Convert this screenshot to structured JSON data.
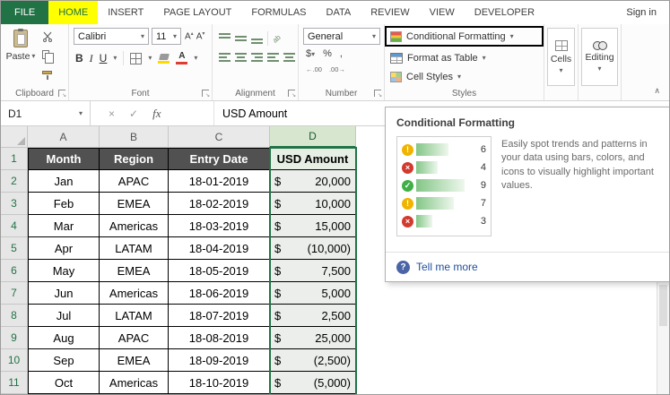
{
  "colors": {
    "excel_green": "#217346",
    "home_tab_highlight": "#ffff00",
    "table_header_fill": "#515151",
    "selected_column_border": "#217346",
    "databar_green": "#84c687",
    "icon_yellow": "#f0b400",
    "icon_red": "#d23a2e",
    "icon_green": "#3faf46",
    "link_blue": "#1f4e9c"
  },
  "icons": {
    "dropdown": "▾",
    "cancel": "×",
    "enter": "✓",
    "fx": "fx",
    "help": "?",
    "collapse": "∧",
    "orientation": "ab",
    "increase_decimal": "←.00",
    "decrease_decimal": ".00→"
  },
  "tab_bar": {
    "file": "FILE",
    "tabs": [
      "HOME",
      "INSERT",
      "PAGE LAYOUT",
      "FORMULAS",
      "DATA",
      "REVIEW",
      "VIEW",
      "DEVELOPER"
    ],
    "sign_in": "Sign in"
  },
  "ribbon": {
    "clipboard": {
      "label": "Clipboard",
      "paste": "Paste"
    },
    "font": {
      "label": "Font",
      "name": "Calibri",
      "size": "11",
      "bold": "B",
      "italic": "I",
      "underline": "U",
      "grow": "A",
      "shrink": "A",
      "color_a": "A"
    },
    "alignment": {
      "label": "Alignment"
    },
    "number": {
      "label": "Number",
      "format": "General",
      "currency": "$",
      "percent": "%",
      "comma": ","
    },
    "styles": {
      "label": "Styles",
      "conditional_formatting": "Conditional Formatting",
      "format_as_table": "Format as Table",
      "cell_styles": "Cell Styles"
    },
    "cells": {
      "label": "Cells"
    },
    "editing": {
      "label": "Editing"
    }
  },
  "formula_bar": {
    "name_box": "D1",
    "content": "USD Amount"
  },
  "tooltip": {
    "title": "Conditional Formatting",
    "description": "Easily spot trends and patterns in your data using bars, colors, and icons to visually highlight important values.",
    "link": "Tell me more",
    "preview": [
      {
        "icon": "icon-warning",
        "value": 6
      },
      {
        "icon": "icon-cross",
        "value": 4
      },
      {
        "icon": "icon-check",
        "value": 9
      },
      {
        "icon": "icon-warning",
        "value": 7
      },
      {
        "icon": "icon-cross",
        "value": 3
      }
    ]
  },
  "sheet": {
    "col_letters": [
      "A",
      "B",
      "C",
      "D"
    ],
    "header_row": {
      "num": "1",
      "month": "Month",
      "region": "Region",
      "date": "Entry Date",
      "amount": "USD Amount"
    },
    "rows": [
      {
        "num": "2",
        "month": "Jan",
        "region": "APAC",
        "date": "18-01-2019",
        "cur": "$",
        "amount": "20,000"
      },
      {
        "num": "3",
        "month": "Feb",
        "region": "EMEA",
        "date": "18-02-2019",
        "cur": "$",
        "amount": "10,000"
      },
      {
        "num": "4",
        "month": "Mar",
        "region": "Americas",
        "date": "18-03-2019",
        "cur": "$",
        "amount": "15,000"
      },
      {
        "num": "5",
        "month": "Apr",
        "region": "LATAM",
        "date": "18-04-2019",
        "cur": "$",
        "amount": "(10,000)"
      },
      {
        "num": "6",
        "month": "May",
        "region": "EMEA",
        "date": "18-05-2019",
        "cur": "$",
        "amount": "7,500"
      },
      {
        "num": "7",
        "month": "Jun",
        "region": "Americas",
        "date": "18-06-2019",
        "cur": "$",
        "amount": "5,000"
      },
      {
        "num": "8",
        "month": "Jul",
        "region": "LATAM",
        "date": "18-07-2019",
        "cur": "$",
        "amount": "2,500"
      },
      {
        "num": "9",
        "month": "Aug",
        "region": "APAC",
        "date": "18-08-2019",
        "cur": "$",
        "amount": "25,000"
      },
      {
        "num": "10",
        "month": "Sep",
        "region": "EMEA",
        "date": "18-09-2019",
        "cur": "$",
        "amount": "(2,500)"
      },
      {
        "num": "11",
        "month": "Oct",
        "region": "Americas",
        "date": "18-10-2019",
        "cur": "$",
        "amount": "(5,000)"
      }
    ]
  }
}
